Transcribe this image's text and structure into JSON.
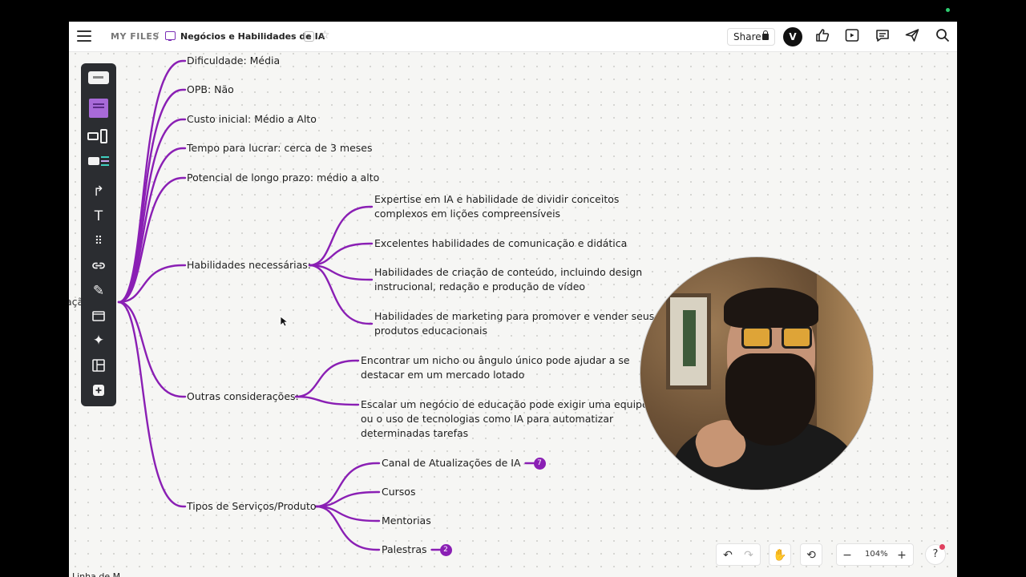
{
  "header": {
    "breadcrumb_root": "MY FILES",
    "breadcrumb_sep": "/",
    "board_title": "Negócios e Habilidades de IA",
    "share_label": "Share",
    "avatar_letter": "V"
  },
  "mindmap": {
    "root_partial": "açã",
    "top_items": [
      "Dificuldade: Média",
      "OPB: Não",
      "Custo inicial: Médio a Alto",
      "Tempo para lucrar: cerca de 3 meses",
      "Potencial de longo prazo: médio a alto"
    ],
    "skills": {
      "label": "Habilidades necessárias:",
      "children": [
        [
          "Expertise em IA e habilidade de dividir conceitos",
          "complexos em lições compreensíveis"
        ],
        [
          "Excelentes habilidades de comunicação e didática"
        ],
        [
          "Habilidades de criação de conteúdo, incluindo design",
          "instrucional, redação e produção de vídeo"
        ],
        [
          "Habilidades de marketing para promover e vender seus",
          "produtos educacionais"
        ]
      ]
    },
    "other": {
      "label": "Outras considerações:",
      "children": [
        [
          "Encontrar um nicho ou ângulo único pode ajudar a se",
          "destacar em um mercado lotado"
        ],
        [
          "Escalar um negócio de educação pode exigir uma equipe",
          "ou o uso de tecnologias como IA para automatizar",
          "determinadas tarefas"
        ]
      ]
    },
    "types": {
      "label": "Tipos de Serviços/Produto",
      "children": [
        {
          "label": "Canal de Atualizações de IA",
          "badge": "7"
        },
        {
          "label": "Cursos"
        },
        {
          "label": "Mentorias"
        },
        {
          "label": "Palestras",
          "badge": "2"
        }
      ]
    },
    "bottom_partial": "Linha de M"
  },
  "controls": {
    "zoom": "104%",
    "help": "?"
  },
  "colors": {
    "branch": "#8a1fb4",
    "toolbar_bg": "#2b2d31"
  }
}
